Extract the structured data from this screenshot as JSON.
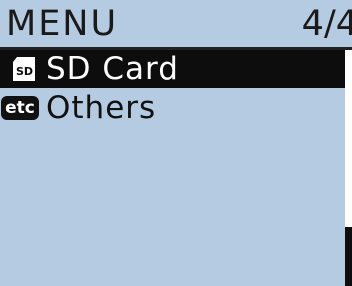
{
  "header": {
    "title": "MENU",
    "page_indicator": "4/4"
  },
  "menu": {
    "items": [
      {
        "label": "SD Card",
        "icon": "sd-card-icon",
        "icon_text": "SD",
        "selected": true
      },
      {
        "label": "Others",
        "icon": "etc-icon",
        "icon_text": "etc",
        "selected": false
      }
    ]
  },
  "scrollbar": {
    "thumb_start_fraction": 0.75,
    "thumb_end_fraction": 1.0
  },
  "colors": {
    "screen_background": "#b5cbe2",
    "selected_background": "#0d0d0d",
    "selected_text": "#ffffff",
    "text": "#111111"
  }
}
